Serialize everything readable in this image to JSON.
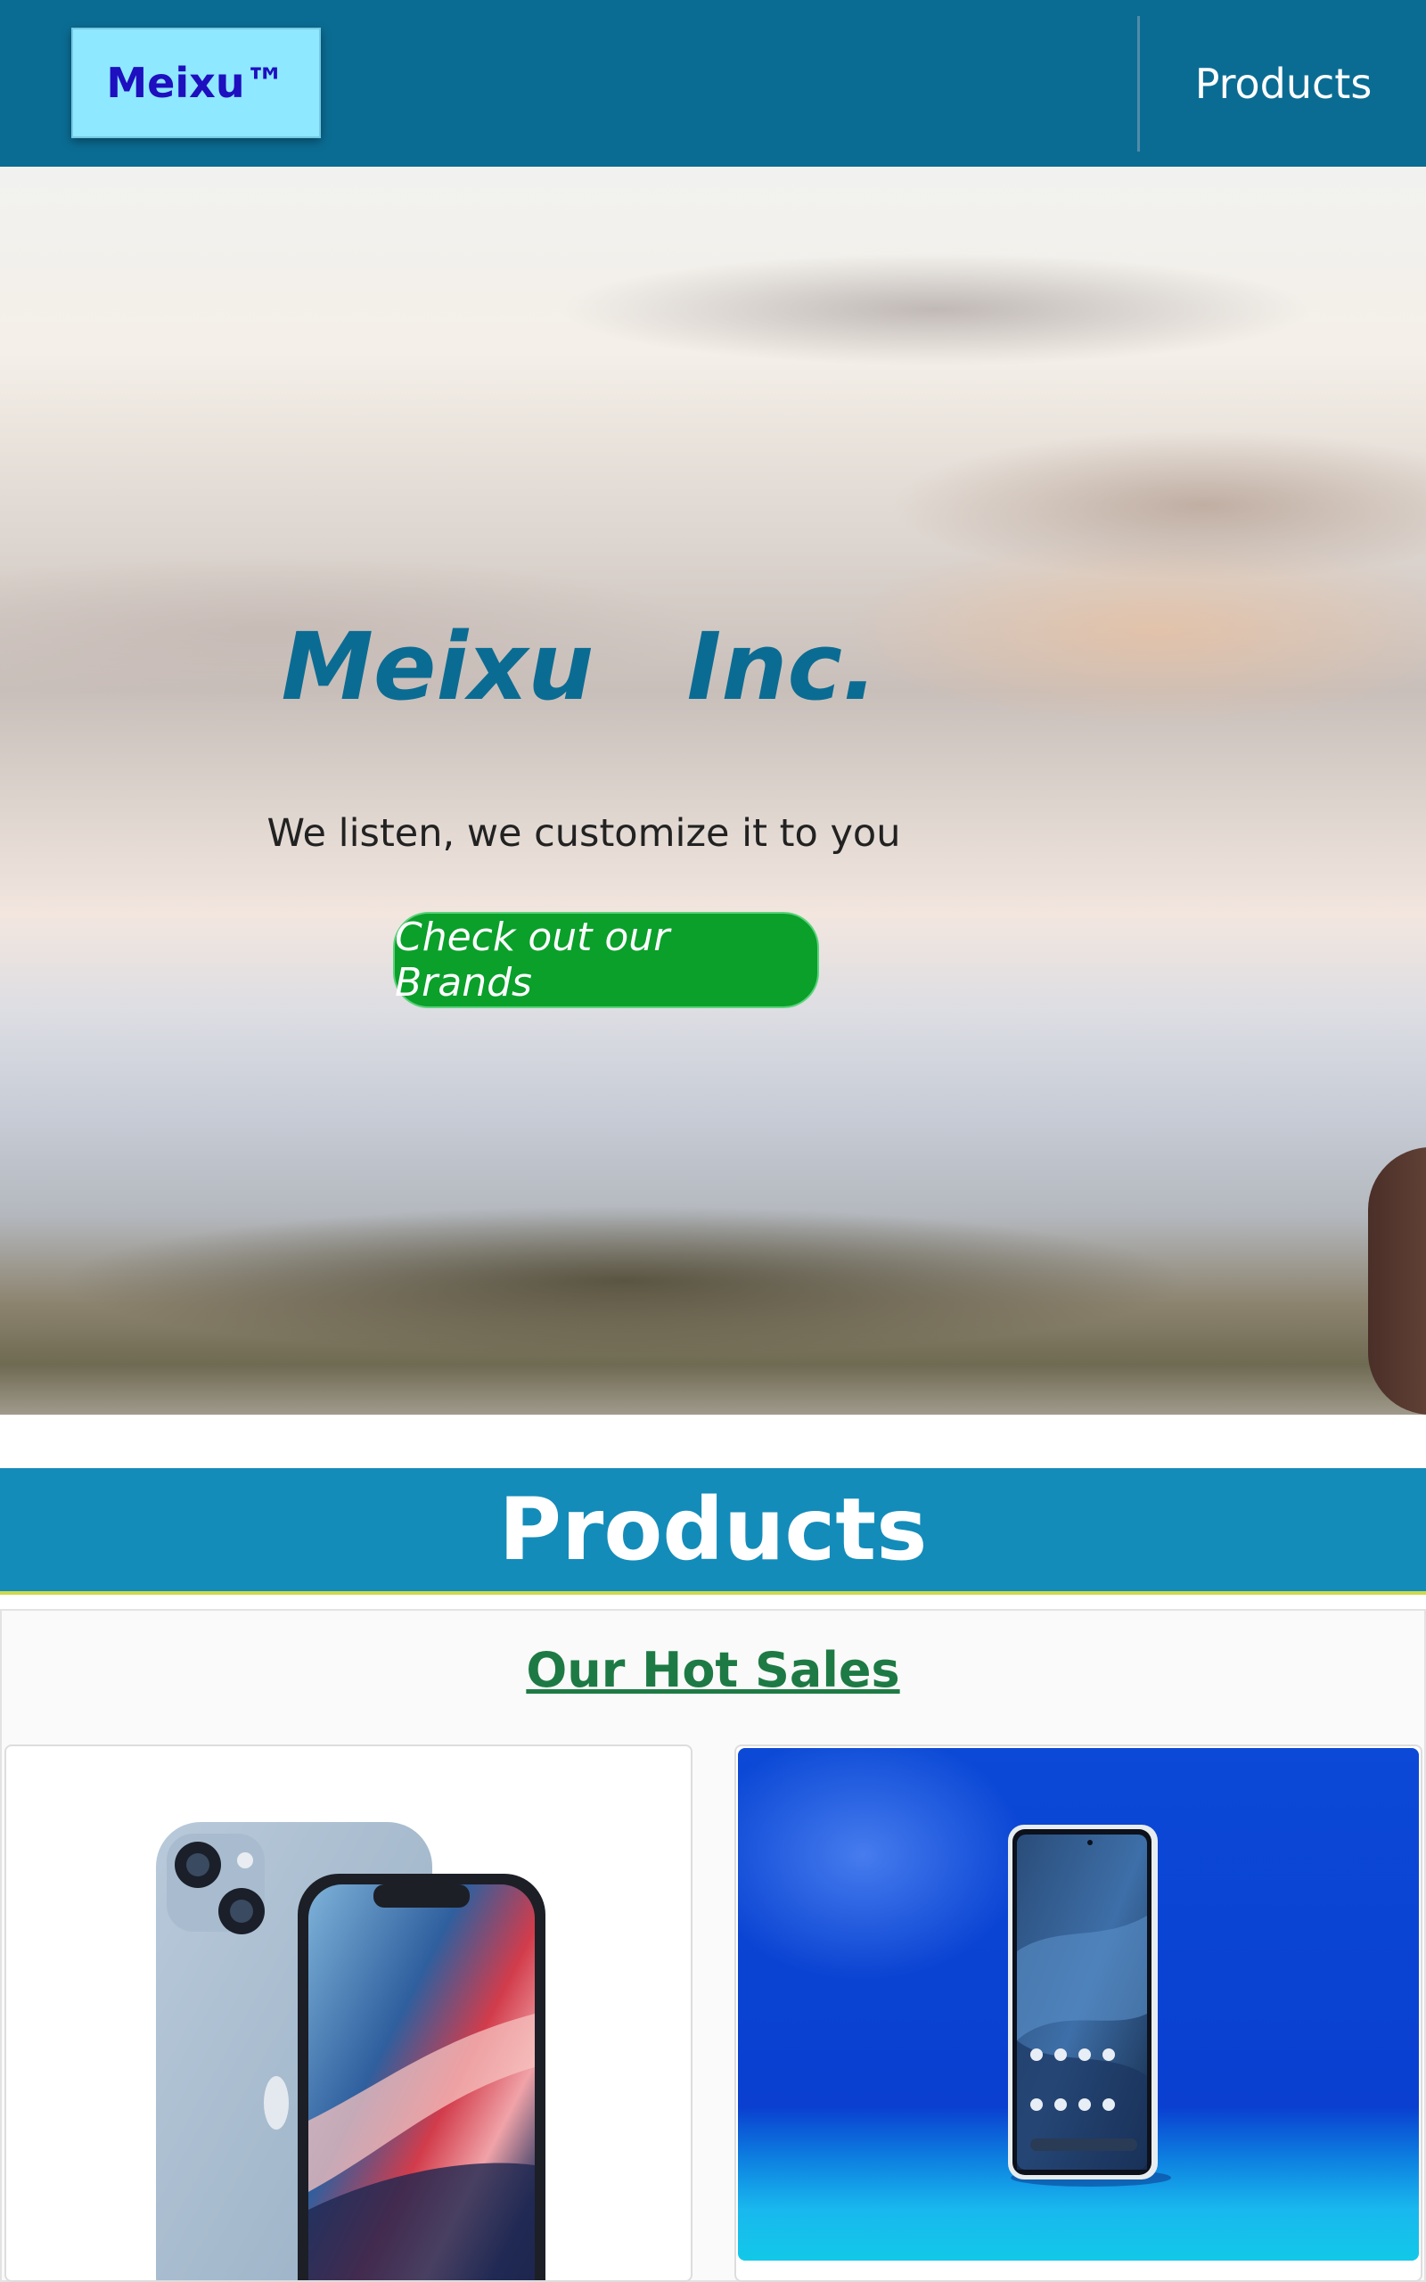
{
  "navbar": {
    "brand": "Meixu™",
    "link_products": "Products"
  },
  "hero": {
    "title": "Meixu  Inc.",
    "subtitle": "We listen, we customize it to you",
    "cta": "Check out our Brands"
  },
  "products_section": {
    "heading": "Products",
    "hot_sales": "Our Hot Sales",
    "cards": [
      {
        "image": "iphone-product-image"
      },
      {
        "image": "android-phone-product-image"
      }
    ]
  },
  "colors": {
    "navbar": "#0b6c93",
    "brand_bg": "#8ee8ff",
    "brand_text": "#1e0fbf",
    "cta": "#0aa02a",
    "section_header": "#138cba",
    "hot_sales": "#1e7a44"
  }
}
